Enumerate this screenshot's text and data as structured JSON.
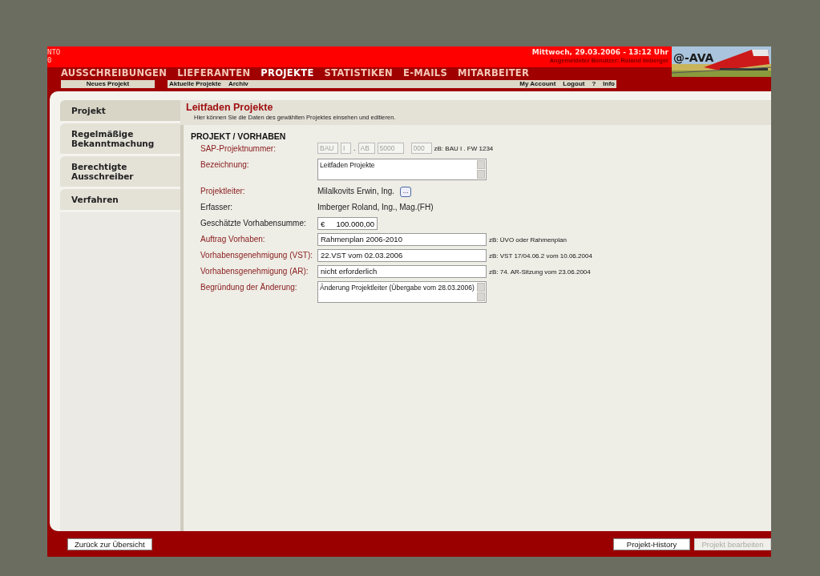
{
  "header": {
    "fragments": [
      "NTO",
      "0"
    ],
    "date": "Mittwoch, 29.03.2006 - 13:12 Uhr",
    "user": "Angemeldeter Benutzer: Roland Imberger",
    "logo": "@-AVA"
  },
  "nav": [
    {
      "label": "AUSSCHREIBUNGEN",
      "selected": false
    },
    {
      "label": "LIEFERANTEN",
      "selected": false
    },
    {
      "label": "PROJEKTE",
      "selected": true
    },
    {
      "label": "STATISTIKEN",
      "selected": false
    },
    {
      "label": "E-MAILS",
      "selected": false
    },
    {
      "label": "MITARBEITER",
      "selected": false
    }
  ],
  "subnav": {
    "new": "Neues Projekt",
    "left": [
      "Aktuelle Projekte",
      "Archiv"
    ],
    "right": [
      "My Account",
      "Logout",
      "?",
      "Info"
    ]
  },
  "sidebar": [
    {
      "label": "Projekt",
      "selected": true
    },
    {
      "label": "Regelmäßige Bekanntmachung",
      "selected": false
    },
    {
      "label": "Berechtigte Ausschreiber",
      "selected": false
    },
    {
      "label": "Verfahren",
      "selected": false
    }
  ],
  "page": {
    "title": "Leitfaden Projekte",
    "subtitle": "Hier können Sie die Daten des gewählten Projektes einsehen und editieren.",
    "section": "PROJEKT / VORHABEN"
  },
  "fields": [
    {
      "kind": "sap",
      "label": "SAP-Projektnummer:",
      "required": true,
      "parts": [
        {
          "kind": "input",
          "placeholder": "BAU"
        },
        {
          "kind": "input",
          "placeholder": "I"
        },
        {
          "kind": "sep",
          "value": "."
        },
        {
          "kind": "input",
          "placeholder": "AB"
        },
        {
          "kind": "input",
          "placeholder": "5000"
        },
        {
          "kind": "input",
          "placeholder": "000"
        }
      ],
      "hint": "zB: BAU I . FW 1234"
    },
    {
      "kind": "textarea",
      "label": "Bezeichnung:",
      "required": true,
      "value": "Leitfaden Projekte"
    },
    {
      "kind": "picker",
      "label": "Projektleiter:",
      "required": true,
      "value": "Milalkovits Erwin, Ing.",
      "button": "..."
    },
    {
      "kind": "text",
      "label": "Erfasser:",
      "required": false,
      "value": "Imberger Roland, Ing., Mag.(FH)"
    },
    {
      "kind": "money",
      "label": "Geschätzte Vorhabensumme:",
      "required": false,
      "currency": "€",
      "value": "100.000,00"
    },
    {
      "kind": "input",
      "label": "Auftrag Vorhaben:",
      "required": true,
      "value": "Rahmenplan 2006-2010",
      "hint": "zB: ÜVO oder Rahmenplan"
    },
    {
      "kind": "input",
      "label": "Vorhabensgenehmigung (VST):",
      "required": true,
      "value": "22.VST vom 02.03.2006",
      "hint": "zB: VST 17/04.06.2 vom 10.06.2004"
    },
    {
      "kind": "input",
      "label": "Vorhabensgenehmigung (AR):",
      "required": true,
      "value": "nicht erforderlich",
      "hint": "zB: 74. AR-Sitzung vom 23.06.2004"
    },
    {
      "kind": "textarea",
      "label": "Begründung der Änderung:",
      "required": true,
      "value": "Änderung Projektleiter (Übergabe vom 28.03.2006)"
    }
  ],
  "footer": {
    "back": {
      "label": "Zurück zur Übersicht",
      "disabled": false
    },
    "actions": [
      {
        "label": "Projekt-History",
        "disabled": false
      },
      {
        "label": "Projekt bearbeiten",
        "disabled": true
      }
    ]
  }
}
